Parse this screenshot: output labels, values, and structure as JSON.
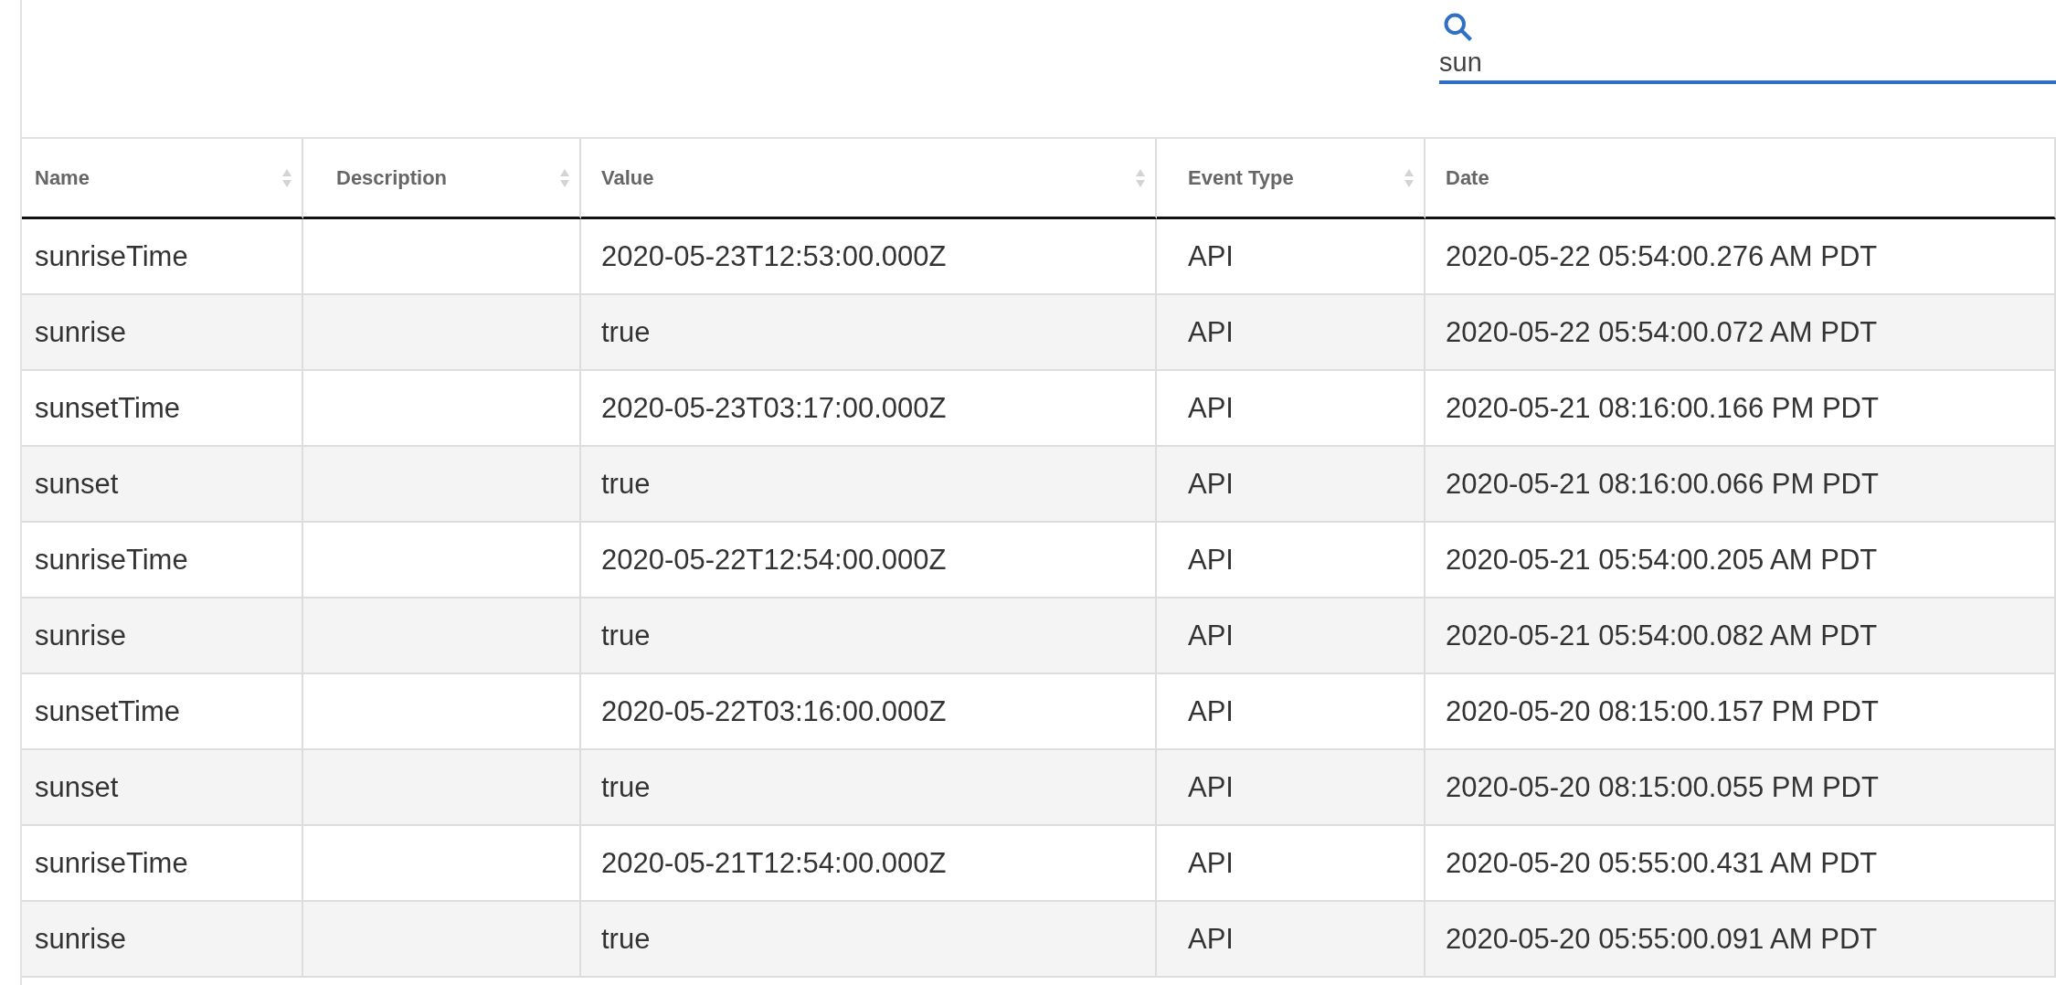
{
  "search": {
    "value": "sun"
  },
  "table": {
    "columns": [
      {
        "label": "Name",
        "sortable": true
      },
      {
        "label": "Description",
        "sortable": true
      },
      {
        "label": "Value",
        "sortable": true
      },
      {
        "label": "Event Type",
        "sortable": true
      },
      {
        "label": "Date",
        "sortable": false
      }
    ],
    "rows": [
      {
        "name": "sunriseTime",
        "value": "2020-05-23T12:53:00.000Z",
        "event_type": "API",
        "date": "2020-05-22 05:54:00.276 AM PDT"
      },
      {
        "name": "sunrise",
        "value": "true",
        "event_type": "API",
        "date": "2020-05-22 05:54:00.072 AM PDT"
      },
      {
        "name": "sunsetTime",
        "value": "2020-05-23T03:17:00.000Z",
        "event_type": "API",
        "date": "2020-05-21 08:16:00.166 PM PDT"
      },
      {
        "name": "sunset",
        "value": "true",
        "event_type": "API",
        "date": "2020-05-21 08:16:00.066 PM PDT"
      },
      {
        "name": "sunriseTime",
        "value": "2020-05-22T12:54:00.000Z",
        "event_type": "API",
        "date": "2020-05-21 05:54:00.205 AM PDT"
      },
      {
        "name": "sunrise",
        "value": "true",
        "event_type": "API",
        "date": "2020-05-21 05:54:00.082 AM PDT"
      },
      {
        "name": "sunsetTime",
        "value": "2020-05-22T03:16:00.000Z",
        "event_type": "API",
        "date": "2020-05-20 08:15:00.157 PM PDT"
      },
      {
        "name": "sunset",
        "value": "true",
        "event_type": "API",
        "date": "2020-05-20 08:15:00.055 PM PDT"
      },
      {
        "name": "sunriseTime",
        "value": "2020-05-21T12:54:00.000Z",
        "event_type": "API",
        "date": "2020-05-20 05:55:00.431 AM PDT"
      },
      {
        "name": "sunrise",
        "value": "true",
        "event_type": "API",
        "date": "2020-05-20 05:55:00.091 AM PDT"
      }
    ]
  }
}
